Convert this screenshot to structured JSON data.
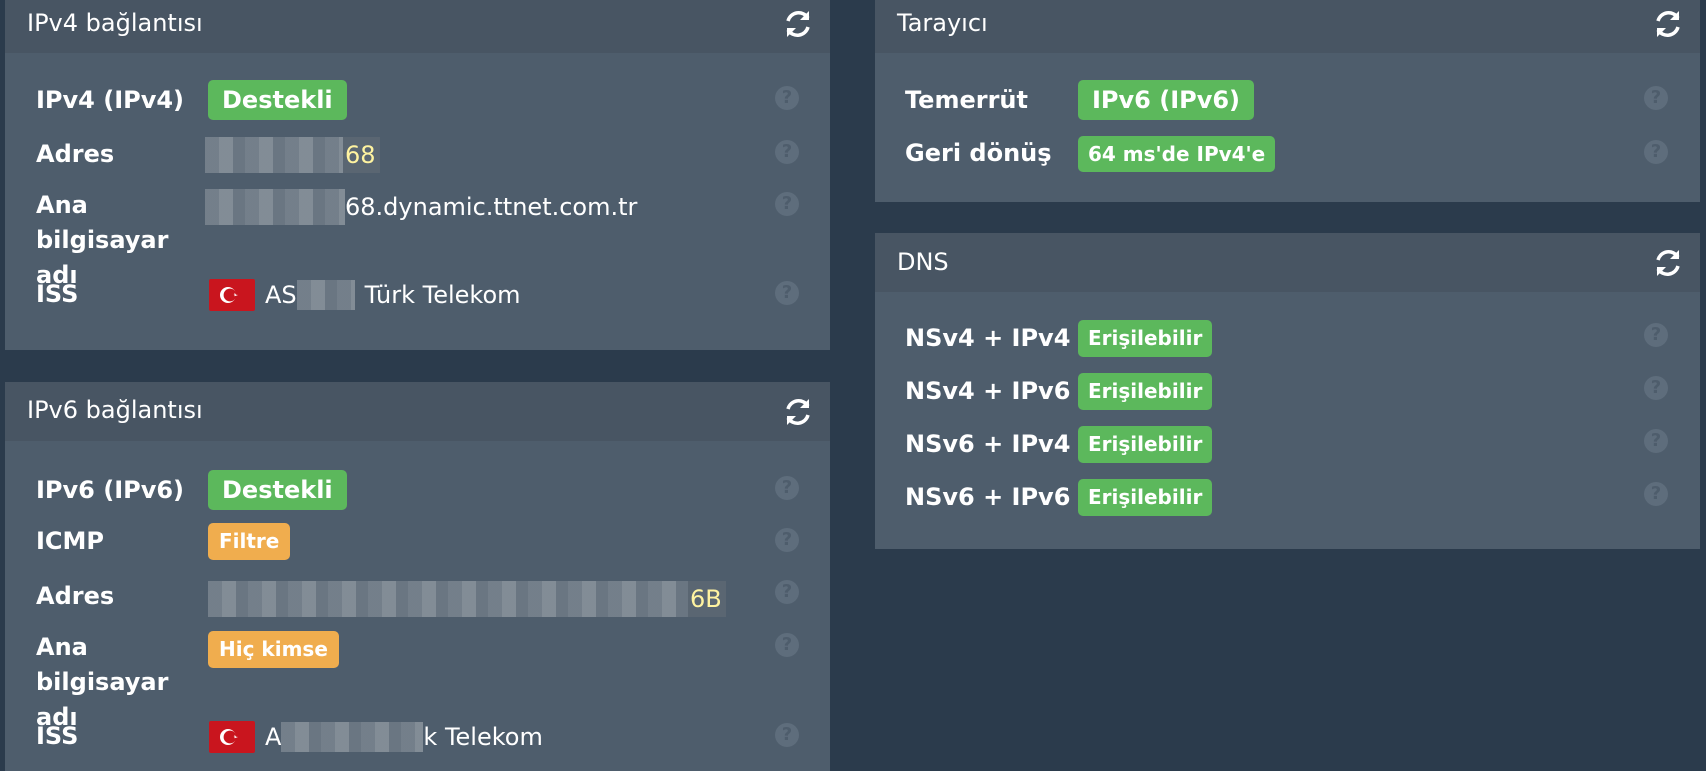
{
  "ipv4": {
    "title": "IPv4 bağlantısı",
    "rows": [
      {
        "label": "IPv4 (IPv4)",
        "badge": "Destekli"
      },
      {
        "label": "Adres",
        "value_suffix": "68"
      },
      {
        "label": "Ana bilgisayar adı",
        "value": "68.dynamic.ttnet.com.tr"
      },
      {
        "label": "ISS",
        "value_prefix": "AS",
        "value": "Türk Telekom"
      }
    ]
  },
  "ipv6": {
    "title": "IPv6 bağlantısı",
    "rows": [
      {
        "label": "IPv6 (IPv6)",
        "badge": "Destekli"
      },
      {
        "label": "ICMP",
        "badge": "Filtre"
      },
      {
        "label": "Adres",
        "value_suffix": "6B"
      },
      {
        "label": "Ana bilgisayar adı",
        "badge": "Hiç kimse"
      },
      {
        "label": "ISS",
        "value_prefix": "A",
        "value": "k Telekom"
      }
    ]
  },
  "browser": {
    "title": "Tarayıcı",
    "rows": [
      {
        "label": "Temerrüt",
        "badge": "IPv6 (IPv6)"
      },
      {
        "label": "Geri dönüş",
        "badge": "64 ms'de IPv4'e"
      }
    ]
  },
  "dns": {
    "title": "DNS",
    "rows": [
      {
        "label": "NSv4 + IPv4",
        "badge": "Erişilebilir"
      },
      {
        "label": "NSv4 + IPv6",
        "badge": "Erişilebilir"
      },
      {
        "label": "NSv6 + IPv4",
        "badge": "Erişilebilir"
      },
      {
        "label": "NSv6 + IPv6",
        "badge": "Erişilebilir"
      }
    ]
  },
  "help_symbol": "?",
  "colors": {
    "background": "#2b3b4c",
    "panel": "#4e5d6c",
    "panel_header": "#485563",
    "success": "#5cb85c",
    "warning": "#f0ad4e"
  },
  "icons": {
    "refresh": "refresh-icon",
    "help": "help-icon",
    "flag": "turkey-flag-icon"
  }
}
